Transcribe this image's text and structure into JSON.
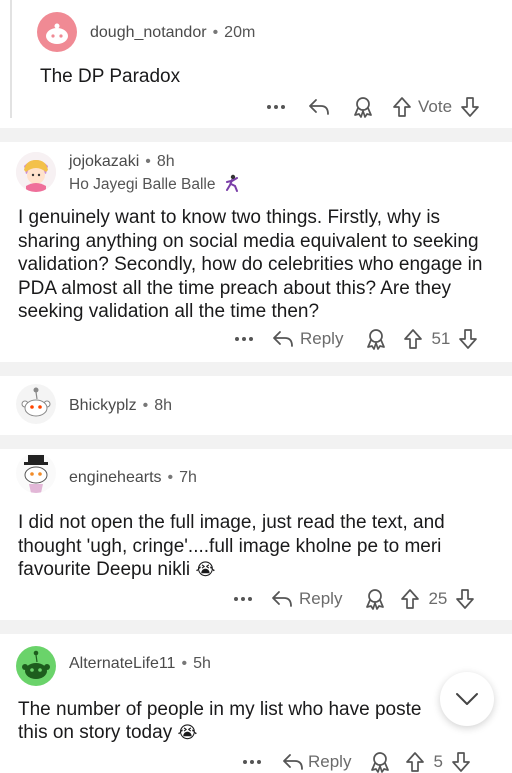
{
  "comments": [
    {
      "username": "dough_notandor",
      "time": "20m",
      "flair": "",
      "text": "The DP Paradox",
      "reply_label": "",
      "vote_label": "Vote"
    },
    {
      "username": "jojokazaki",
      "time": "8h",
      "flair": "Ho Jayegi Balle Balle",
      "text": "I genuinely want to know two things. Firstly, why is sharing anything on social media equivalent to seeking validation? Secondly, how do celebrities who engage in PDA almost all the time preach about this? Are they seeking validation all the time then?",
      "reply_label": "Reply",
      "vote_label": "51"
    },
    {
      "username": "Bhickyplz",
      "time": "8h"
    },
    {
      "username": "enginehearts",
      "time": "7h",
      "text": "I did not open the full image, just read the text, and thought 'ugh, cringe'....full image kholne pe to meri favourite Deepu nikli",
      "reply_label": "Reply",
      "vote_label": "25"
    },
    {
      "username": "AlternateLife11",
      "time": "5h",
      "text": "The number of people in my list who have poste",
      "text_line2": "this on story today",
      "reply_label": "Reply",
      "vote_label": "5"
    }
  ],
  "icons": {
    "more": "more-dots-icon",
    "reply": "reply-arrow-icon",
    "award": "award-icon",
    "upvote": "upvote-arrow-icon",
    "downvote": "downvote-arrow-icon",
    "scroll": "chevron-down-icon",
    "emoji": "loudly-crying-face-emoji"
  },
  "colors": {
    "avatar_pink": "#f08a94",
    "avatar_green": "#6ad36a",
    "gap_gray": "#f2f2f2",
    "meta_gray": "#6b6b6b"
  }
}
